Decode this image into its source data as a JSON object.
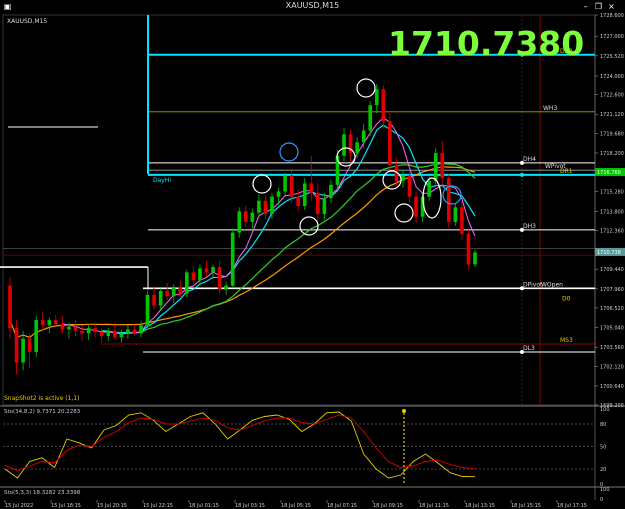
{
  "window": {
    "title": "XAUUSD,M15",
    "symbol_label": "XAUUSD,M15"
  },
  "big_price": "1710.7380",
  "status_text": "SnapShot2 is active (1,1)",
  "stoch_label": "Sto(34,8,2) 9.7371 20.2283",
  "stoch2_label": "Sto(5,3,3) 18.3282 23.3398",
  "colors": {
    "bull": "#00c800",
    "bear": "#e00000",
    "blue_ma": "#00e5ff",
    "green_ma": "#2fd02f",
    "orange_ma": "#ff9900",
    "magenta": "#ff66ff"
  },
  "chart_data": [
    {
      "type": "candlestick",
      "title": "XAUUSD,M15",
      "ylim": [
        1699.2,
        1728.6
      ],
      "y_ticks": [
        "1728.600",
        "1727.000",
        "1725.520",
        "1724.000",
        "1722.600",
        "1721.120",
        "1719.680",
        "1718.200",
        "1716.760",
        "1715.280",
        "1713.800",
        "1712.360",
        "1710.800",
        "1709.440",
        "1707.960",
        "1706.520",
        "1705.040",
        "1703.560",
        "1702.120",
        "1700.640",
        "1699.200"
      ],
      "x_ticks": [
        "15 Jul 2022",
        "15 Jul 18:15",
        "15 Jul 20:15",
        "15 Jul 22:15",
        "18 Jul 01:15",
        "18 Jul 03:15",
        "18 Jul 05:15",
        "18 Jul 07:15",
        "18 Jul 09:15",
        "18 Jul 11:15",
        "18 Jul 13:15",
        "18 Jul 15:15",
        "18 Jul 17:15"
      ],
      "price_markers": [
        {
          "label": "1710.738",
          "value": 1710.738
        },
        {
          "label": "1716.760",
          "value": 1716.76
        }
      ],
      "levels": [
        {
          "label": "DR2",
          "value": 1725.6
        },
        {
          "label": "WH3",
          "value": 1721.3
        },
        {
          "label": "DH4",
          "value": 1717.45
        },
        {
          "label": "WPivot",
          "value": 1716.9
        },
        {
          "label": "DR1",
          "value": 1716.55
        },
        {
          "label": "DayHi",
          "value": 1716.55
        },
        {
          "label": "DH3",
          "value": 1712.4
        },
        {
          "label": "DPivot",
          "value": 1708.0
        },
        {
          "label": "WOpen",
          "value": 1708.0
        },
        {
          "label": "D0",
          "value": 1707.6
        },
        {
          "label": "MS3",
          "value": 1703.8
        },
        {
          "label": "DL3",
          "value": 1703.2
        }
      ],
      "candles": [
        [
          1708.2,
          1708.8,
          1704.2,
          1705.0
        ],
        [
          1705.0,
          1705.6,
          1701.5,
          1702.4
        ],
        [
          1702.4,
          1704.8,
          1701.8,
          1704.2
        ],
        [
          1704.2,
          1704.6,
          1702.0,
          1703.2
        ],
        [
          1703.2,
          1705.9,
          1702.8,
          1705.6
        ],
        [
          1705.6,
          1706.2,
          1704.8,
          1705.2
        ],
        [
          1705.2,
          1705.8,
          1704.6,
          1705.6
        ],
        [
          1705.6,
          1706.0,
          1705.0,
          1705.3
        ],
        [
          1705.3,
          1705.9,
          1704.6,
          1704.9
        ],
        [
          1704.9,
          1705.4,
          1704.2,
          1705.1
        ],
        [
          1705.1,
          1705.6,
          1704.4,
          1704.8
        ],
        [
          1704.8,
          1705.2,
          1704.0,
          1704.6
        ],
        [
          1704.6,
          1705.3,
          1704.1,
          1705.0
        ],
        [
          1705.0,
          1705.4,
          1704.3,
          1704.7
        ],
        [
          1704.7,
          1705.0,
          1703.9,
          1704.4
        ],
        [
          1704.4,
          1705.0,
          1704.0,
          1704.8
        ],
        [
          1704.8,
          1705.2,
          1704.1,
          1704.3
        ],
        [
          1704.3,
          1704.9,
          1703.9,
          1704.6
        ],
        [
          1704.6,
          1705.2,
          1704.2,
          1704.9
        ],
        [
          1704.9,
          1705.3,
          1704.4,
          1704.6
        ],
        [
          1704.6,
          1705.5,
          1704.3,
          1705.2
        ],
        [
          1705.2,
          1707.8,
          1705.0,
          1707.5
        ],
        [
          1707.5,
          1708.2,
          1706.4,
          1706.7
        ],
        [
          1706.7,
          1708.0,
          1706.3,
          1707.8
        ],
        [
          1707.8,
          1708.4,
          1707.1,
          1707.4
        ],
        [
          1707.4,
          1708.3,
          1706.9,
          1708.1
        ],
        [
          1708.1,
          1708.6,
          1707.3,
          1707.6
        ],
        [
          1707.6,
          1709.4,
          1707.3,
          1709.2
        ],
        [
          1709.2,
          1709.7,
          1708.3,
          1708.6
        ],
        [
          1708.6,
          1709.8,
          1708.2,
          1709.5
        ],
        [
          1709.5,
          1710.1,
          1708.9,
          1709.2
        ],
        [
          1709.2,
          1709.8,
          1708.7,
          1709.6
        ],
        [
          1709.6,
          1710.0,
          1707.6,
          1707.9
        ],
        [
          1707.9,
          1708.5,
          1707.5,
          1708.2
        ],
        [
          1708.2,
          1712.5,
          1708.0,
          1712.2
        ],
        [
          1712.2,
          1714.1,
          1711.8,
          1713.8
        ],
        [
          1713.8,
          1714.2,
          1712.6,
          1713.0
        ],
        [
          1713.0,
          1714.0,
          1712.5,
          1713.7
        ],
        [
          1713.7,
          1715.1,
          1713.3,
          1714.6
        ],
        [
          1714.6,
          1715.0,
          1713.2,
          1713.6
        ],
        [
          1713.6,
          1715.2,
          1713.2,
          1714.9
        ],
        [
          1714.9,
          1715.6,
          1714.3,
          1715.3
        ],
        [
          1715.3,
          1716.7,
          1714.9,
          1716.5
        ],
        [
          1716.5,
          1716.9,
          1714.5,
          1714.9
        ],
        [
          1714.9,
          1715.5,
          1713.8,
          1714.2
        ],
        [
          1714.2,
          1716.3,
          1713.9,
          1715.9
        ],
        [
          1715.9,
          1718.0,
          1714.6,
          1715.2
        ],
        [
          1715.2,
          1715.9,
          1713.0,
          1713.6
        ],
        [
          1713.6,
          1715.2,
          1713.2,
          1714.8
        ],
        [
          1714.8,
          1716.2,
          1714.4,
          1715.8
        ],
        [
          1715.8,
          1718.4,
          1715.4,
          1718.0
        ],
        [
          1718.0,
          1720.1,
          1717.6,
          1719.6
        ],
        [
          1719.6,
          1720.0,
          1717.6,
          1718.2
        ],
        [
          1718.2,
          1719.4,
          1717.8,
          1719.0
        ],
        [
          1719.0,
          1720.4,
          1718.6,
          1719.9
        ],
        [
          1719.9,
          1722.1,
          1719.5,
          1721.8
        ],
        [
          1721.8,
          1723.4,
          1721.2,
          1723.0
        ],
        [
          1723.0,
          1723.3,
          1720.1,
          1720.6
        ],
        [
          1720.6,
          1721.2,
          1716.9,
          1717.3
        ],
        [
          1717.3,
          1717.8,
          1715.7,
          1716.1
        ],
        [
          1716.1,
          1716.9,
          1715.6,
          1716.5
        ],
        [
          1716.5,
          1716.9,
          1714.5,
          1714.9
        ],
        [
          1714.9,
          1715.3,
          1712.9,
          1713.4
        ],
        [
          1713.4,
          1715.2,
          1713.0,
          1714.9
        ],
        [
          1714.9,
          1716.4,
          1714.6,
          1716.1
        ],
        [
          1716.1,
          1718.6,
          1715.8,
          1718.2
        ],
        [
          1718.2,
          1719.1,
          1715.9,
          1716.3
        ],
        [
          1716.3,
          1716.6,
          1712.6,
          1713.0
        ],
        [
          1713.0,
          1714.4,
          1712.7,
          1714.1
        ],
        [
          1714.1,
          1714.6,
          1711.6,
          1712.1
        ],
        [
          1712.1,
          1712.4,
          1709.4,
          1709.8
        ],
        [
          1709.8,
          1710.9,
          1709.6,
          1710.7
        ]
      ]
    },
    {
      "type": "line",
      "title": "Sto(34,8,2) 9.7371 20.2283",
      "ylim": [
        0,
        100
      ],
      "y_ticks": [
        "100",
        "80",
        "50",
        "20",
        "0"
      ],
      "series": [
        {
          "values": [
            20,
            8,
            30,
            35,
            22,
            60,
            55,
            48,
            72,
            78,
            92,
            95,
            85,
            70,
            80,
            90,
            95,
            80,
            60,
            72,
            85,
            90,
            92,
            86,
            70,
            80,
            95,
            96,
            84,
            40,
            20,
            8,
            12,
            30,
            40,
            28,
            15,
            10,
            9.7
          ]
        },
        {
          "values": [
            25,
            18,
            24,
            30,
            28,
            45,
            52,
            50,
            62,
            70,
            82,
            88,
            86,
            80,
            80,
            84,
            88,
            85,
            75,
            72,
            78,
            84,
            88,
            88,
            82,
            80,
            86,
            92,
            88,
            70,
            48,
            30,
            22,
            24,
            30,
            32,
            26,
            22,
            20.2
          ]
        }
      ]
    },
    {
      "type": "line",
      "title": "Sto(5,3,3) 18.3282 23.3398",
      "y_ticks": [
        "100",
        "0"
      ]
    }
  ]
}
